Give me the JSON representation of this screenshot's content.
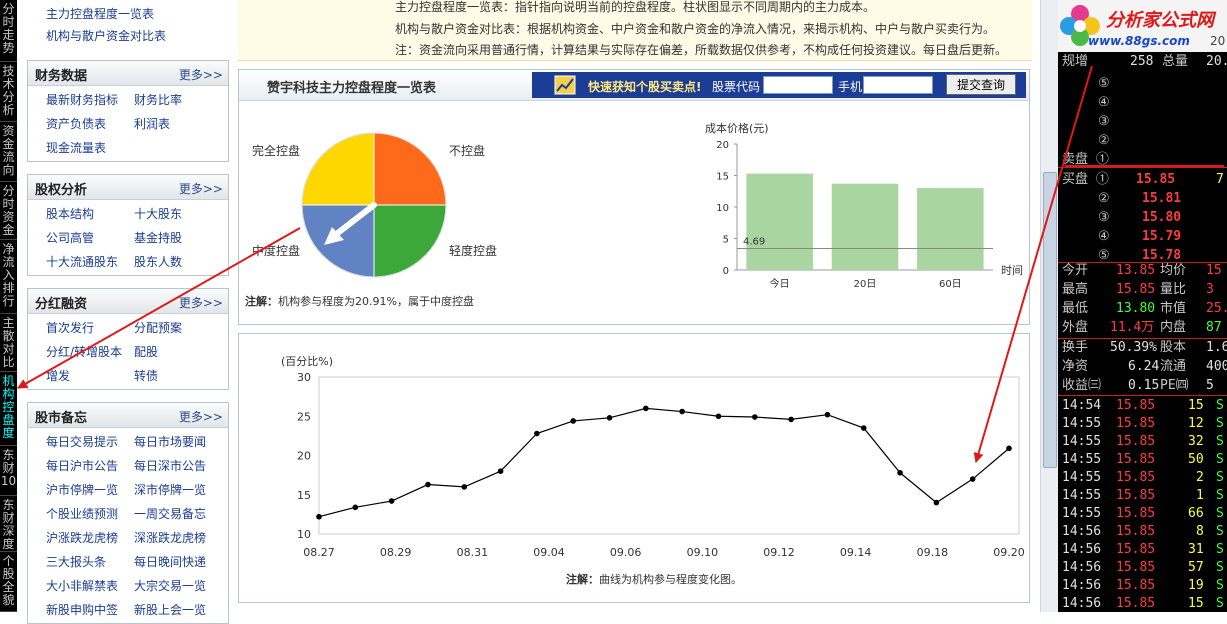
{
  "vtabs": [
    {
      "label": "分时走势"
    },
    {
      "label": "技术分析"
    },
    {
      "label": "资金流向"
    },
    {
      "label": "分时资金"
    },
    {
      "label": "净流入排行"
    },
    {
      "label": "主散对比"
    },
    {
      "label": "机构控盘度"
    },
    {
      "label": "东财10"
    },
    {
      "label": "东财深度"
    },
    {
      "label": "个股全貌"
    }
  ],
  "left": {
    "top_links": [
      "主力控盘程度一览表",
      "机构与散户资金对比表"
    ],
    "sections": [
      {
        "title": "财务数据",
        "more": "更多>>",
        "items": [
          "最新财务指标",
          "财务比率",
          "资产负债表",
          "利润表",
          "现金流量表"
        ]
      },
      {
        "title": "股权分析",
        "more": "更多>>",
        "items": [
          "股本结构",
          "十大股东",
          "公司高管",
          "基金持股",
          "十大流通股东",
          "股东人数"
        ]
      },
      {
        "title": "分红融资",
        "more": "更多>>",
        "items": [
          "首次发行",
          "分配预案",
          "分红/转增股本",
          "配股",
          "增发",
          "转债"
        ]
      },
      {
        "title": "股市备忘",
        "more": "更多>>",
        "items": [
          "每日交易提示",
          "每日市场要闻",
          "每日沪市公告",
          "每日深市公告",
          "沪市停牌一览",
          "深市停牌一览",
          "个股业绩预测",
          "一周交易备忘",
          "沪涨跌龙虎榜",
          "深涨跌龙虎榜",
          "三大报头条",
          "每日晚间快递",
          "大小非解禁表",
          "大宗交易一览",
          "新股申购中签",
          "新股上会一览"
        ]
      }
    ]
  },
  "notice": [
    "主力控盘程度一览表：指针指向说明当前的控盘程度。柱状图显示不同周期内的主力成本。",
    "机构与散户资金对比表：根据机构资金、中户资金和散户资金的净流入情况，来揭示机构、中户与散户买卖行为。",
    "注：资金流向采用普通行情，计算结果与实际存在偏差，所载数据仅供参考，不构成任何投资建议。每日盘后更新。"
  ],
  "panel1": {
    "title": "赞宇科技主力控盘程度一览表",
    "query": {
      "promo": "快速获知个股买卖点!",
      "code_label": "股票代码",
      "phone_label": "手机",
      "button": "提交查询"
    },
    "pie_labels": {
      "full": "完全控盘",
      "none": "不控盘",
      "medium": "中度控盘",
      "light": "轻度控盘"
    },
    "note_label": "注解：",
    "note_text": "机构参与程度为20.91%，属于中度控盘"
  },
  "panel2": {
    "note_label": "注解：",
    "note_text": "曲线为机构参与程度变化图。"
  },
  "colors": {
    "full": "#ffd700",
    "none": "#ff6a1a",
    "medium": "#6183c4",
    "light": "#3ca83a",
    "bar": "#a9d6a0",
    "line": "#000000"
  },
  "chart_data": [
    {
      "type": "pie",
      "categories": [
        "完全控盘",
        "不控盘",
        "轻度控盘",
        "中度控盘"
      ],
      "values": [
        25,
        25,
        25,
        25
      ],
      "pointer_value": 20.91
    },
    {
      "type": "bar",
      "title": "",
      "ylabel": "成本价格(元)",
      "xlabel": "时间",
      "categories": [
        "今日",
        "20日",
        "60日"
      ],
      "values": [
        15.3,
        13.7,
        13.0
      ],
      "ylim": [
        0,
        20
      ],
      "yticks": [
        0,
        5,
        10,
        15,
        20
      ],
      "reference_line": {
        "value": 4.69,
        "label": "4.69"
      }
    },
    {
      "type": "line",
      "ylabel": "(百分比%)",
      "ylim": [
        10,
        30
      ],
      "yticks": [
        10,
        15,
        20,
        25,
        30
      ],
      "x_tick_labels": [
        "08.27",
        "08.29",
        "08.31",
        "09.04",
        "09.06",
        "09.10",
        "09.12",
        "09.14",
        "09.18",
        "09.20"
      ],
      "values": [
        12.2,
        13.4,
        14.2,
        16.3,
        16.0,
        18.0,
        22.8,
        24.4,
        24.8,
        26.0,
        25.6,
        25.0,
        24.9,
        24.6,
        25.2,
        23.5,
        17.8,
        14.0,
        17.0,
        20.91
      ]
    }
  ],
  "quote": {
    "logo_title": "分析家公式网",
    "logo_url": "www.88gs.com",
    "logo_url_suffix": "20",
    "header": {
      "l1": "规增",
      "v1": "258",
      "l2": "总量",
      "v2": "20."
    },
    "sell": [
      {
        "label": "⑤",
        "price": "",
        "vol": ""
      },
      {
        "label": "④",
        "price": "",
        "vol": ""
      },
      {
        "label": "③",
        "price": "",
        "vol": ""
      },
      {
        "label": "②",
        "price": "",
        "vol": ""
      },
      {
        "label": "卖盘 ①",
        "price": "",
        "vol": ""
      }
    ],
    "buy": [
      {
        "label": "买盘 ①",
        "price": "15.85",
        "vol": "7"
      },
      {
        "label": "②",
        "price": "15.81",
        "vol": ""
      },
      {
        "label": "③",
        "price": "15.80",
        "vol": ""
      },
      {
        "label": "④",
        "price": "15.79",
        "vol": ""
      },
      {
        "label": "⑤",
        "price": "15.78",
        "vol": ""
      }
    ],
    "stats": [
      {
        "l1": "今开",
        "v1": "13.85",
        "l2": "均价",
        "v2": "15"
      },
      {
        "l1": "最高",
        "v1": "15.85",
        "l2": "量比",
        "v2": "3"
      },
      {
        "l1": "最低",
        "v1": "13.80",
        "l2": "市值",
        "v2": "25."
      },
      {
        "l1": "外盘",
        "v1": "11.4万",
        "l2": "内盘",
        "v2": "87"
      }
    ],
    "stats2": [
      {
        "l1": "换手",
        "v1": "50.39%",
        "l2": "股本",
        "v2": "1.6"
      },
      {
        "l1": "净资",
        "v1": "6.24",
        "l2": "流通",
        "v2": "400"
      },
      {
        "l1": "收益㈢",
        "v1": "0.15",
        "l2": "PE㈣",
        "v2": "5"
      }
    ],
    "ticks": [
      {
        "t": "14:54",
        "p": "15.85",
        "v": "15",
        "s": "S"
      },
      {
        "t": "14:55",
        "p": "15.85",
        "v": "12",
        "s": "S"
      },
      {
        "t": "14:55",
        "p": "15.85",
        "v": "32",
        "s": "S"
      },
      {
        "t": "14:55",
        "p": "15.85",
        "v": "50",
        "s": "S"
      },
      {
        "t": "14:55",
        "p": "15.85",
        "v": "2",
        "s": "S"
      },
      {
        "t": "14:55",
        "p": "15.85",
        "v": "1",
        "s": "S"
      },
      {
        "t": "14:55",
        "p": "15.85",
        "v": "66",
        "s": "S"
      },
      {
        "t": "14:56",
        "p": "15.85",
        "v": "8",
        "s": "S"
      },
      {
        "t": "14:56",
        "p": "15.85",
        "v": "31",
        "s": "S"
      },
      {
        "t": "14:56",
        "p": "15.85",
        "v": "57",
        "s": "S"
      },
      {
        "t": "14:56",
        "p": "15.85",
        "v": "19",
        "s": "S"
      },
      {
        "t": "14:56",
        "p": "15.85",
        "v": "15",
        "s": "S"
      }
    ]
  }
}
